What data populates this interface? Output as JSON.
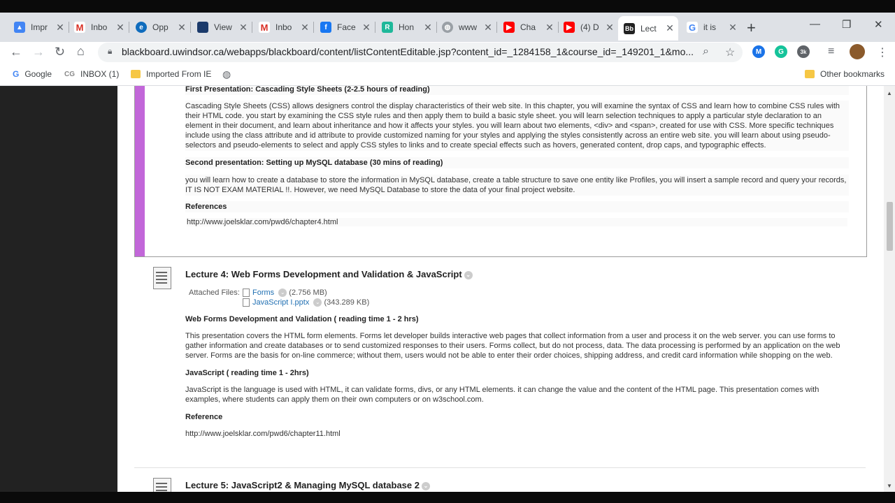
{
  "browser": {
    "tabs": [
      {
        "title": "Impr",
        "icon": "drive-icon",
        "color": "#4285f4"
      },
      {
        "title": "Inbo",
        "icon": "gmail-icon",
        "color": "#d93025"
      },
      {
        "title": "Opp",
        "icon": "edge-icon",
        "color": "#0f6cbd"
      },
      {
        "title": "View",
        "icon": "view-icon",
        "color": "#1b3a6b"
      },
      {
        "title": "Inbo",
        "icon": "gmail-icon",
        "color": "#d93025"
      },
      {
        "title": "Face",
        "icon": "facebook-icon",
        "color": "#1877f2"
      },
      {
        "title": "Hon",
        "icon": "r-icon",
        "color": "#1fb89a"
      },
      {
        "title": "www",
        "icon": "globe-icon",
        "color": "#777777"
      },
      {
        "title": "Cha",
        "icon": "youtube-icon",
        "color": "#ff0000"
      },
      {
        "title": "(4) D",
        "icon": "youtube-icon",
        "color": "#ff0000"
      },
      {
        "title": "Lect",
        "icon": "blackboard-icon",
        "color": "#222222"
      },
      {
        "title": "it is",
        "icon": "google-icon",
        "color": "#4285f4"
      }
    ],
    "url": "blackboard.uwindsor.ca/webapps/blackboard/content/listContentEditable.jsp?content_id=_1284158_1&course_id=_149201_1&mo...",
    "extension_badge": "3k",
    "bookmarks": {
      "google": "Google",
      "inbox": "INBOX (1)",
      "imported": "Imported From IE",
      "other": "Other bookmarks"
    }
  },
  "lecture3": {
    "first_presentation_heading": "First Presentation:  Cascading Style Sheets (2-2.5 hours of reading)",
    "css_paragraph": "Cascading Style Sheets (CSS) allows designers control the display characteristics of their web site. In this chapter, you will examine the syntax of CSS and learn how to combine CSS rules with their HTML code. you start by examining the CSS style rules and then apply them to build a basic style sheet. you will learn selection techniques to apply a particular style declaration to an element in their document, and learn about inheritance and how it affects your styles. you will learn about two elements, <div> and <span>, created for use with CSS. More specific techniques include using the class attribute and id attribute to provide customized naming for your styles and applying the styles consistently across an entire web site. you will learn about using pseudo-selectors and pseudo-elements to select and apply CSS styles to links and to create special effects such as hovers, generated content, drop caps, and typographic effects.",
    "second_presentation_heading": "Second presentation: Setting up MySQL database (30 mins of reading)",
    "mysql_paragraph": "you will learn how to create a database to store the information in MySQL database, create a table structure to save one entity like Profiles, you will insert a sample record and query your records, IT IS NOT EXAM MATERIAL !!. However, we need MySQL Database to store the data of your final project website.",
    "references_heading": "References",
    "reference_url": "http://www.joelsklar.com/pwd6/chapter4.html"
  },
  "lecture4": {
    "title": "Lecture 4: Web Forms Development and Validation & JavaScript",
    "attached_label": "Attached Files:",
    "files": [
      {
        "name": "Forms",
        "size": "(2.756 MB)"
      },
      {
        "name": "JavaScript I.pptx",
        "size": "(343.289 KB)"
      }
    ],
    "forms_heading": "Web Forms Development and Validation ( reading time 1 - 2 hrs)",
    "forms_paragraph": "This presentation covers the HTML form elements. Forms let developer builds interactive web pages that collect information from a user and process it on the web server. you can use forms to gather information and create databases or to send customized responses to their users. Forms collect, but do not process, data. The data processing is performed by an application on the web server. Forms are the basis for on-line commerce; without them, users would not be able to enter their order choices, shipping address, and credit card information while shopping on the web.",
    "js_heading": "JavaScript ( reading time 1 - 2hrs)",
    "js_paragraph": "JavaScript is the language is used with HTML, it can validate forms, divs, or any HTML elements. it can change the value and the content of the HTML page. This presentation comes with examples, where students can apply them on their own computers or on w3school.com.",
    "reference_heading": "Reference",
    "reference_url": "http://www.joelsklar.com/pwd6/chapter11.html"
  },
  "lecture5": {
    "title": "Lecture 5: JavaScript2 & Managing MySQL database 2"
  },
  "colors": {
    "accent_bar": "#c267d9",
    "link": "#1f6fb2"
  }
}
